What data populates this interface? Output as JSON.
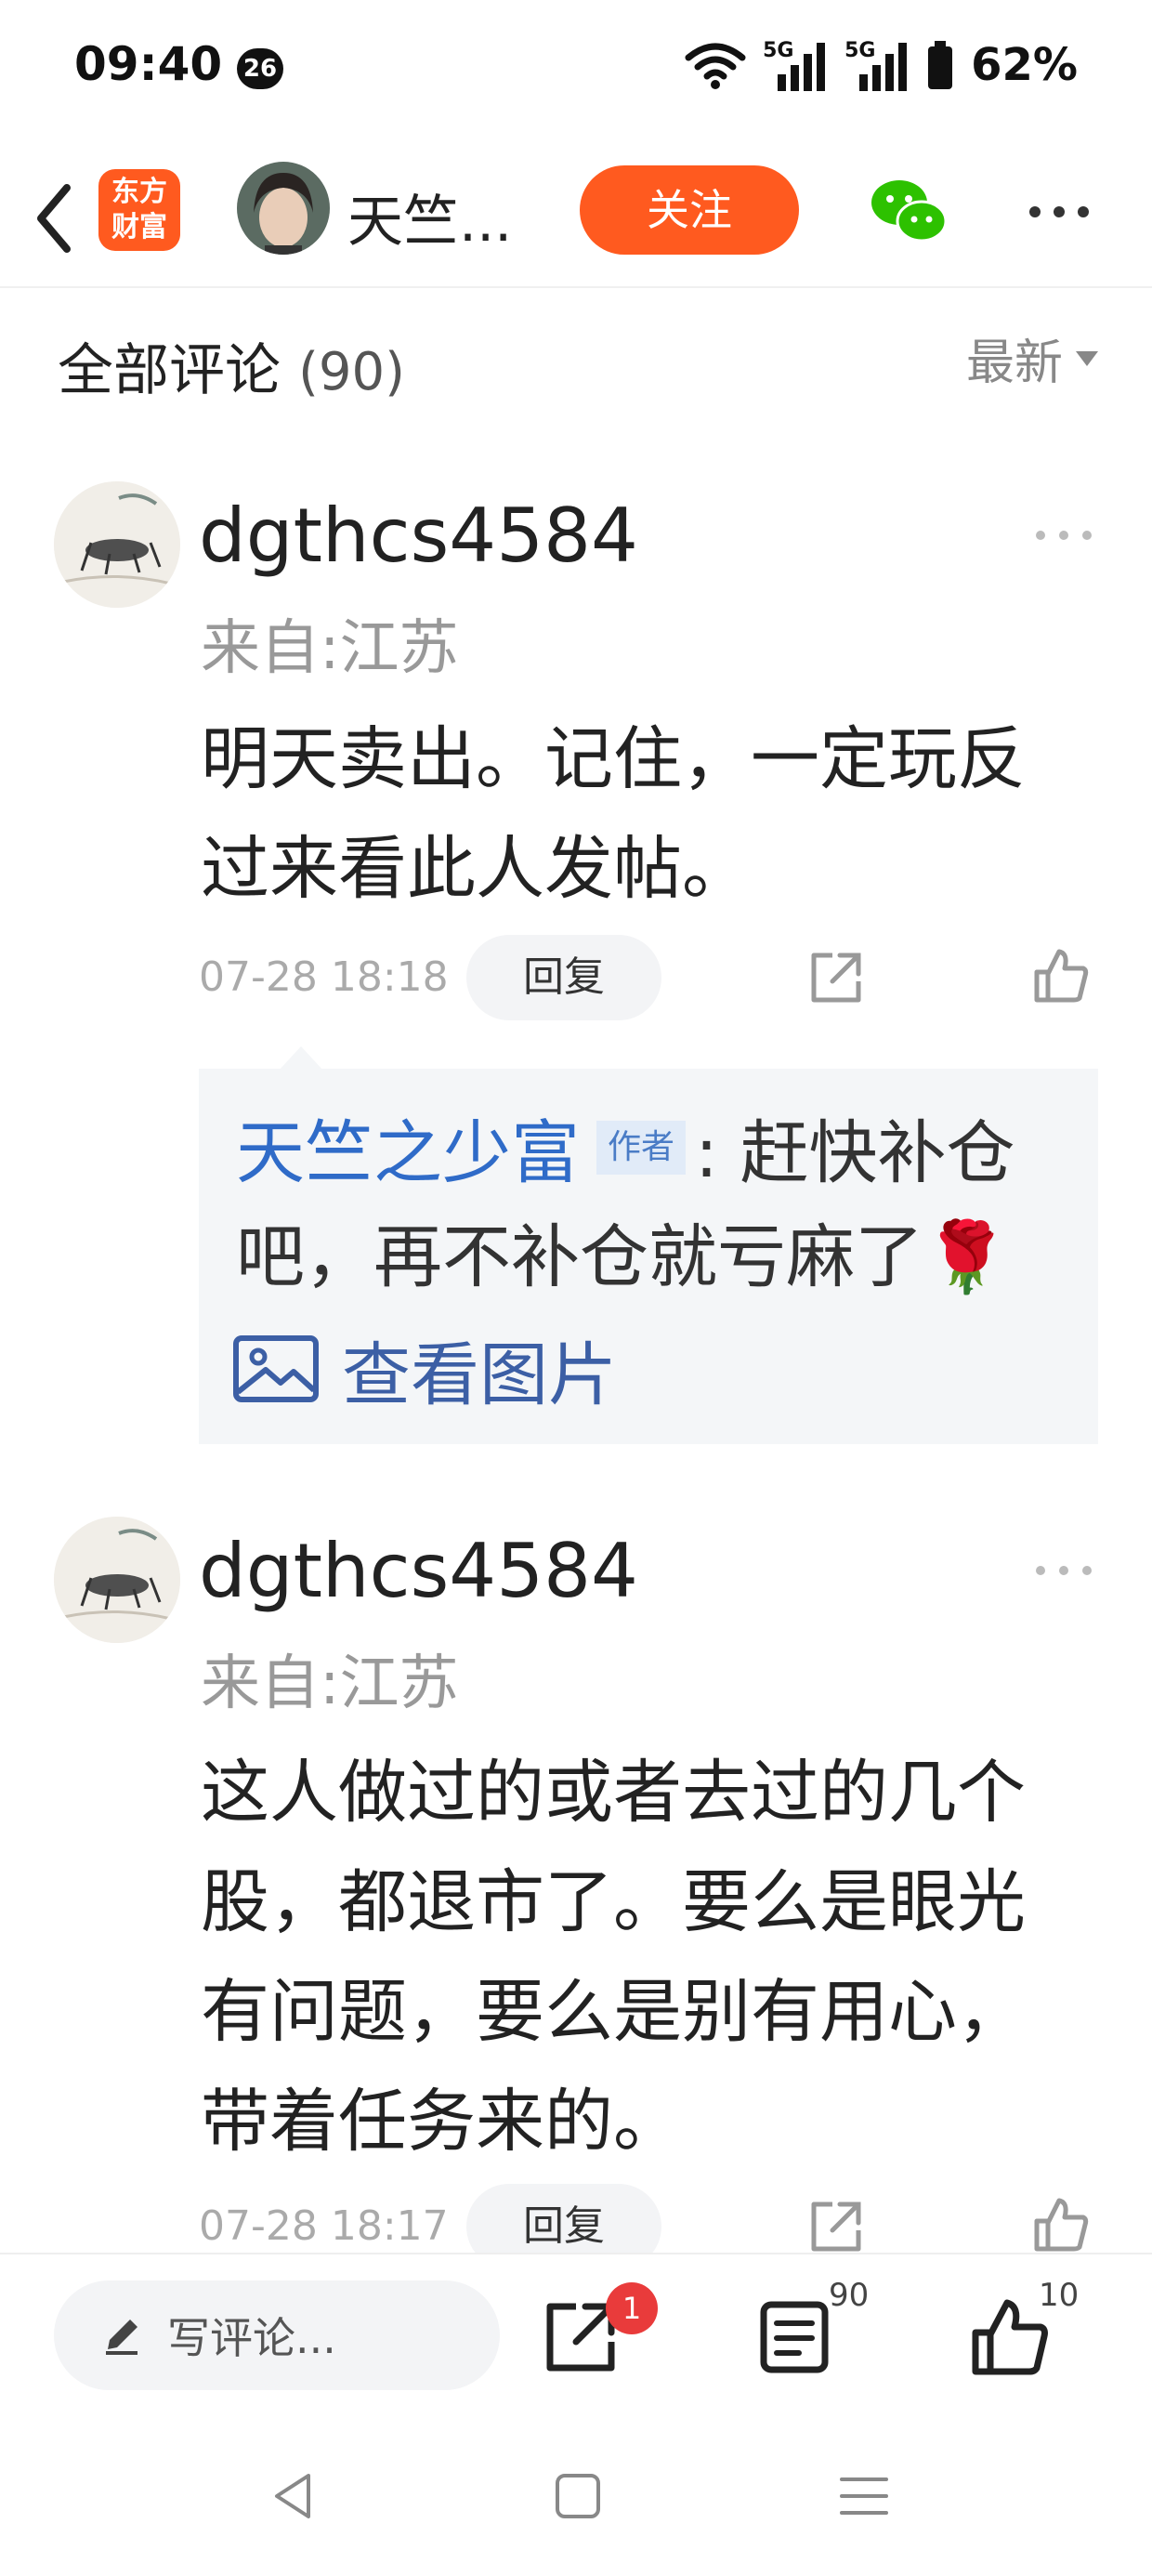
{
  "status_bar": {
    "time": "09:40",
    "notification_count": "26",
    "battery": "62%",
    "network_1": "5G",
    "network_2": "5G"
  },
  "header": {
    "app_logo_line1": "东方",
    "app_logo_line2": "财富",
    "author_name": "天竺...",
    "follow_label": "关注"
  },
  "comments_section": {
    "title": "全部评论",
    "count": "(90)",
    "sort_label": "最新"
  },
  "comments": [
    {
      "username": "dgthcs4584",
      "location": "来自:江苏",
      "text": "明天卖出。记住，一定玩反过来看此人发帖。",
      "date": "07-28 18:18",
      "reply_label": "回复",
      "reply": {
        "author": "天竺之少富",
        "author_tag": "作者",
        "text_line1": ": 赶快补仓",
        "text_line2": "吧，再不补仓就亏麻了🌹",
        "view_image_label": "查看图片"
      }
    },
    {
      "username": "dgthcs4584",
      "location": "来自:江苏",
      "text": "这人做过的或者去过的几个股，都退市了。要么是眼光有问题，要么是别有用心，带着任务来的。",
      "date": "07-28 18:17",
      "reply_label": "回复"
    }
  ],
  "bottom_bar": {
    "write_placeholder": "写评论...",
    "share_badge": "1",
    "comment_count": "90",
    "like_count": "10"
  },
  "colors": {
    "accent": "#ff5a1f",
    "author_link": "#2f6bc8",
    "badge": "#e93b3b"
  }
}
